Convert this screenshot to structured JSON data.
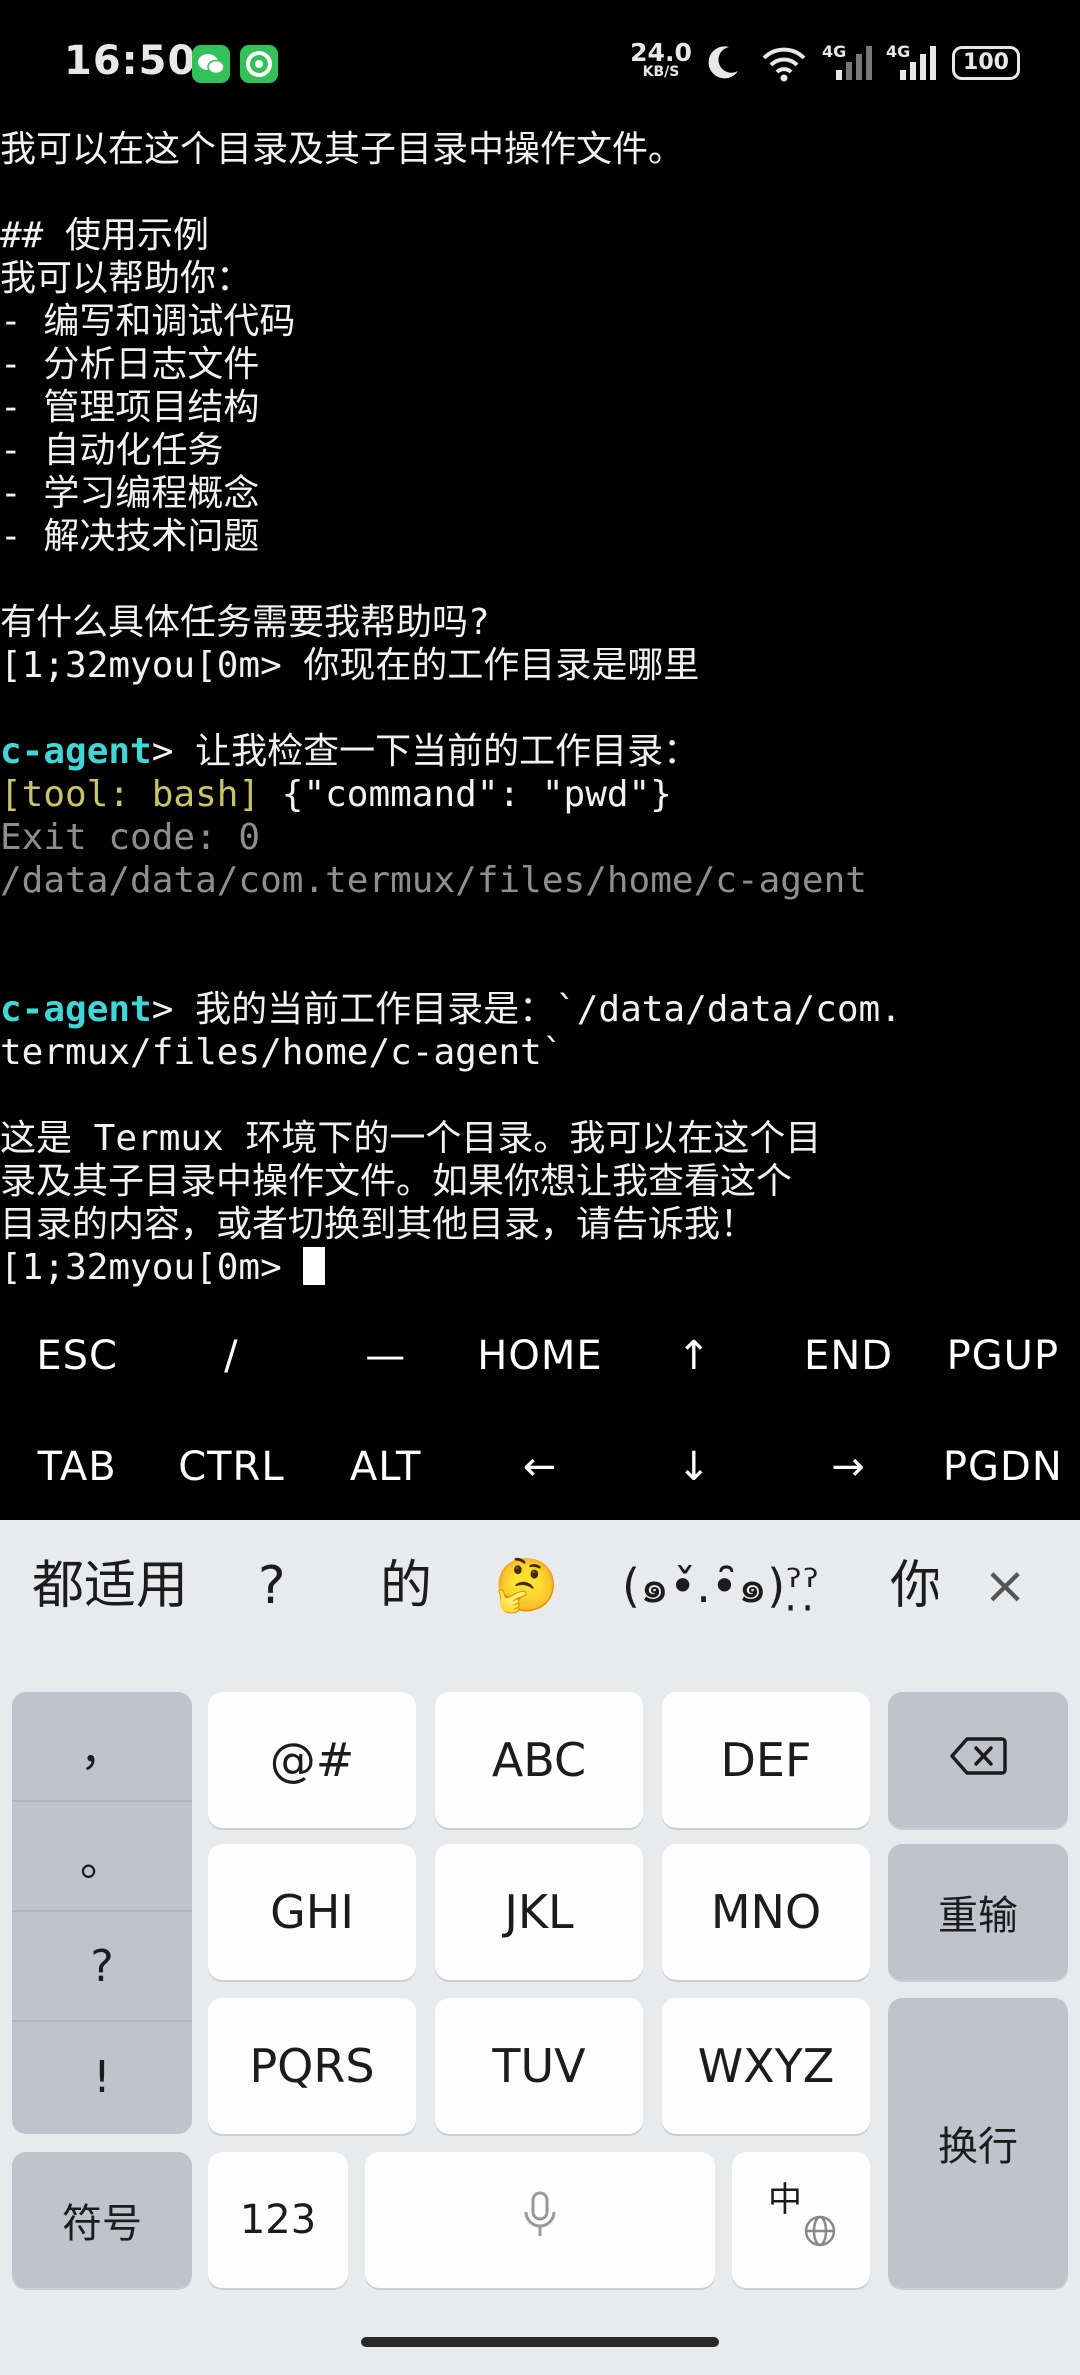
{
  "status_bar": {
    "time": "16:50",
    "net_speed_value": "24.0",
    "net_speed_unit": "KB/S",
    "signal1_label": "4G",
    "signal2_label": "4G",
    "battery": "100",
    "icons": [
      "wechat-icon",
      "app-icon",
      "moon-icon",
      "wifi-icon",
      "signal-icon",
      "battery-icon"
    ]
  },
  "terminal": {
    "lines": [
      "我可以在这个目录及其子目录中操作文件。",
      "",
      "## 使用示例",
      "我可以帮助你：",
      "- 编写和调试代码",
      "- 分析日志文件",
      "- 管理项目结构",
      "- 自动化任务",
      "- 学习编程概念",
      "- 解决技术问题",
      "",
      "有什么具体任务需要我帮助吗?",
      "[1;32myou[0m> 你现在的工作目录是哪里",
      "",
      {
        "agent": "c-agent",
        "rest": "> 让我检查一下当前的工作目录："
      },
      {
        "tool": "[tool: bash]",
        "rest": " {\"command\": \"pwd\"}"
      },
      {
        "dim": "Exit code: 0"
      },
      {
        "dim": "/data/data/com.termux/files/home/c-agent"
      },
      "",
      "",
      {
        "agent": "c-agent",
        "rest": "> 我的当前工作目录是：`/data/data/com."
      },
      "termux/files/home/c-agent`",
      "",
      "这是 Termux 环境下的一个目录。我可以在这个目",
      "录及其子目录中操作文件。如果你想让我查看这个",
      "目录的内容，或者切换到其他目录，请告诉我！",
      "[1;32myou[0m> "
    ]
  },
  "extra_keys": {
    "row1": [
      "ESC",
      "/",
      "—",
      "HOME",
      "↑",
      "END",
      "PGUP"
    ],
    "row2": [
      "TAB",
      "CTRL",
      "ALT",
      "←",
      "↓",
      "→",
      "PGDN"
    ]
  },
  "keyboard": {
    "candidates": [
      "都适用",
      "?",
      "的",
      "🤔",
      "(๑•̌.•̑๑)ˀ̣ˀ̣",
      "你"
    ],
    "close_label": "×",
    "punct_panel": [
      "，",
      "。",
      "?",
      "!"
    ],
    "keys_row1": [
      "@#",
      "ABC",
      "DEF"
    ],
    "keys_row2": [
      "GHI",
      "JKL",
      "MNO"
    ],
    "keys_row3": [
      "PQRS",
      "TUV",
      "WXYZ"
    ],
    "retype_label": "重输",
    "enter_label": "换行",
    "symbols_label": "符号",
    "numbers_label": "123",
    "lang_label": "中"
  }
}
